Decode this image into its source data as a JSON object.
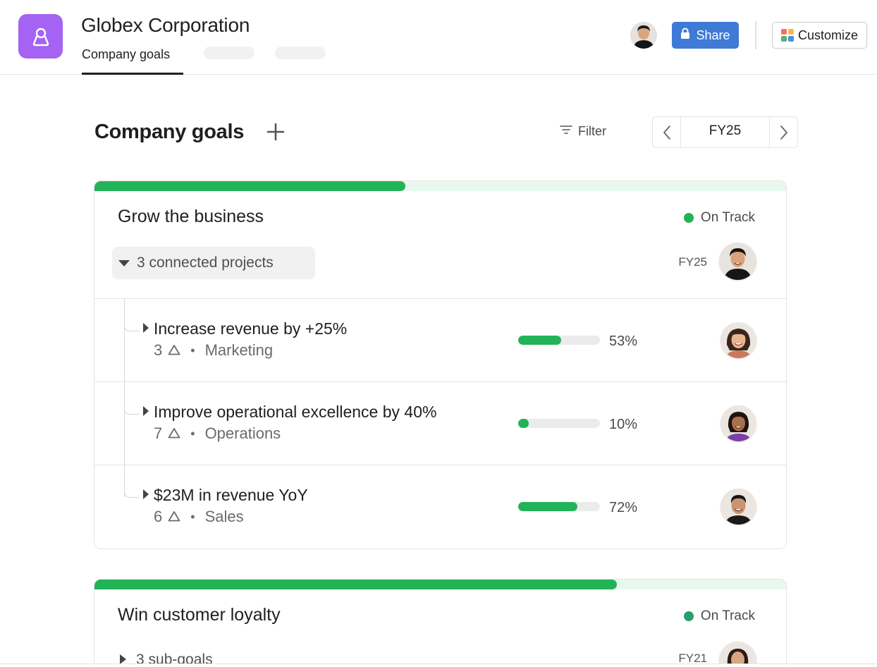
{
  "header": {
    "title": "Globex Corporation",
    "active_tab": "Company goals",
    "share_label": "Share",
    "customize_label": "Customize",
    "app_icon": "goal-person-icon",
    "accent": "#a463f2",
    "share_color": "#3f7ad6"
  },
  "toolbar": {
    "title": "Company goals",
    "add_icon": "plus-icon",
    "filter_label": "Filter",
    "period": "FY25"
  },
  "goals": [
    {
      "title": "Grow the business",
      "progress_fraction": 0.45,
      "status": "On Track",
      "status_color": "#22b356",
      "connected_label": "3 connected projects",
      "period": "FY25",
      "subgoals": [
        {
          "title": "Increase revenue by +25%",
          "count": "3",
          "team": "Marketing",
          "progress": 53,
          "progress_label": "53%"
        },
        {
          "title": "Improve operational excellence by 40%",
          "count": "7",
          "team": "Operations",
          "progress": 10,
          "progress_label": "10%"
        },
        {
          "title": "$23M in revenue YoY",
          "count": "6",
          "team": "Sales",
          "progress": 72,
          "progress_label": "72%"
        }
      ]
    },
    {
      "title": "Win customer loyalty",
      "progress_fraction": 0.755,
      "status": "On Track",
      "status_color": "#2a9d6a",
      "connected_label": "3 sub-goals",
      "period": "FY21"
    }
  ]
}
